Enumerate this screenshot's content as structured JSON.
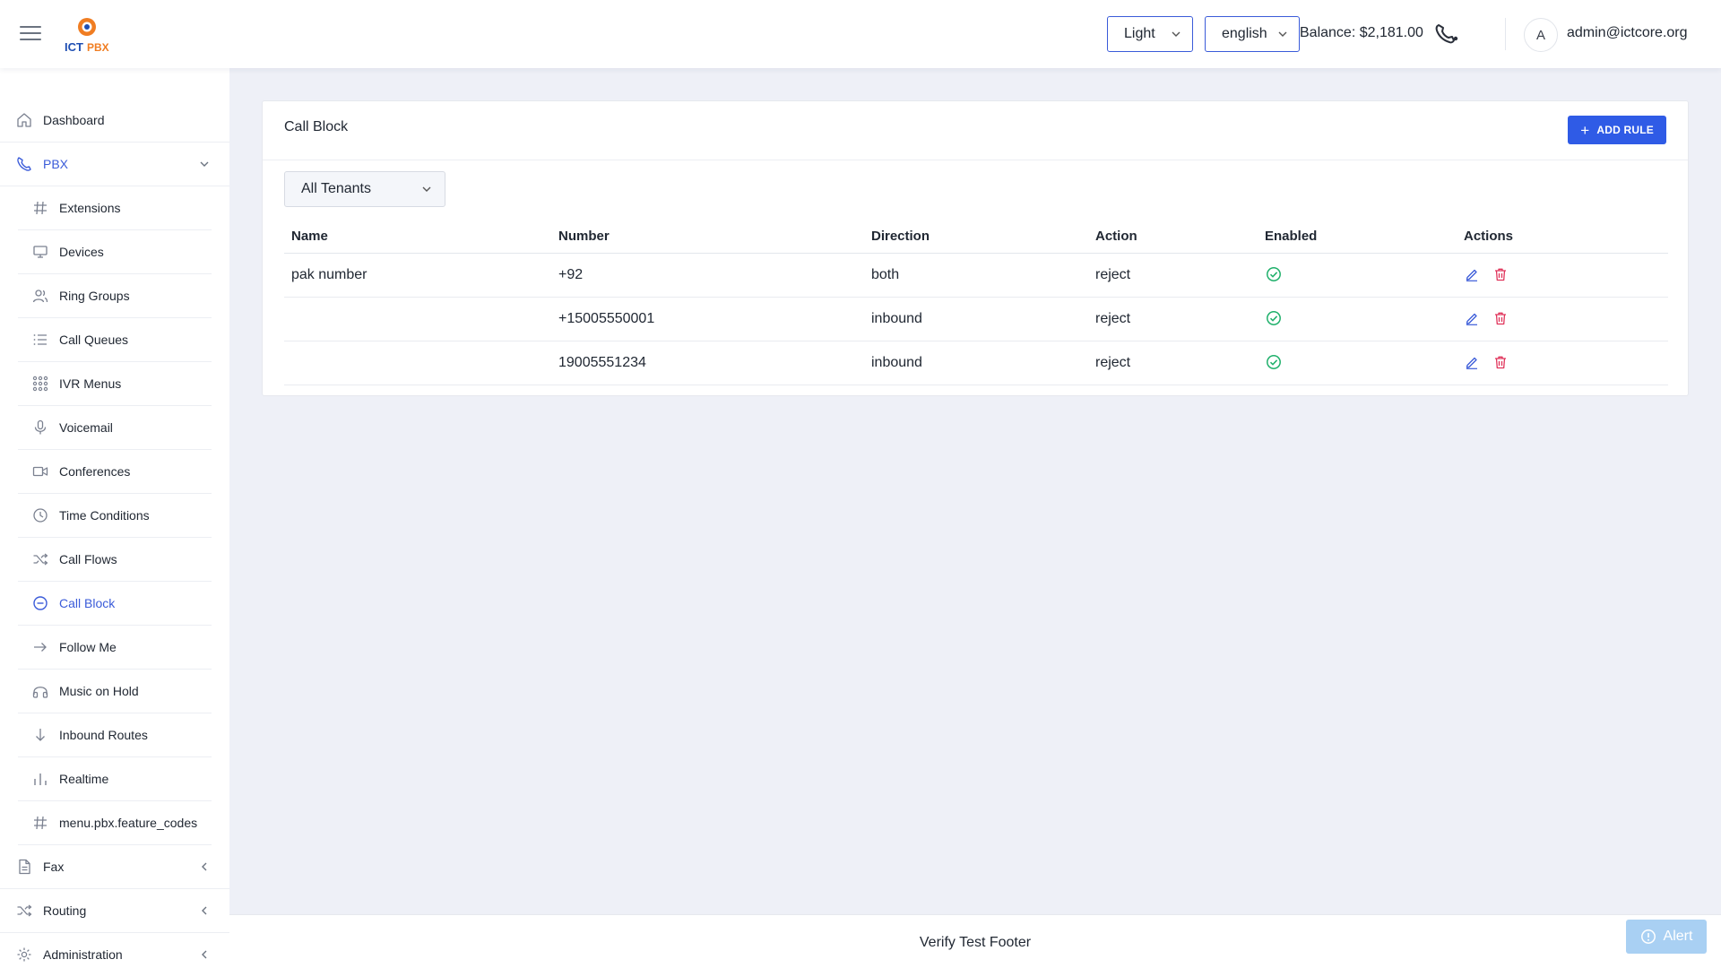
{
  "header": {
    "logo_text": "ICTPBX",
    "theme": {
      "selected": "Light"
    },
    "language": {
      "selected": "english"
    },
    "balance": "Balance: $2,181.00",
    "user": {
      "avatar_initial": "A",
      "email": "admin@ictcore.org"
    }
  },
  "sidebar": {
    "top_items": [
      {
        "label": "Dashboard",
        "icon": "home-icon"
      },
      {
        "label": "PBX",
        "icon": "phone-icon",
        "expanded": true
      }
    ],
    "pbx_items": [
      {
        "label": "Extensions",
        "icon": "hash-icon"
      },
      {
        "label": "Devices",
        "icon": "monitor-icon"
      },
      {
        "label": "Ring Groups",
        "icon": "users-icon"
      },
      {
        "label": "Call Queues",
        "icon": "list-icon"
      },
      {
        "label": "IVR Menus",
        "icon": "grid-icon"
      },
      {
        "label": "Voicemail",
        "icon": "mic-icon"
      },
      {
        "label": "Conferences",
        "icon": "video-icon"
      },
      {
        "label": "Time Conditions",
        "icon": "clock-icon"
      },
      {
        "label": "Call Flows",
        "icon": "shuffle-icon"
      },
      {
        "label": "Call Block",
        "icon": "minus-circle-icon",
        "active": true
      },
      {
        "label": "Follow Me",
        "icon": "arrow-right-icon"
      },
      {
        "label": "Music on Hold",
        "icon": "headphones-icon"
      },
      {
        "label": "Inbound Routes",
        "icon": "arrow-down-icon"
      },
      {
        "label": "Realtime",
        "icon": "bars-icon"
      },
      {
        "label": "menu.pbx.feature_codes",
        "icon": "hash-icon"
      }
    ],
    "bottom_items": [
      {
        "label": "Fax",
        "icon": "file-icon"
      },
      {
        "label": "Routing",
        "icon": "shuffle-icon"
      },
      {
        "label": "Administration",
        "icon": "gear-icon"
      }
    ]
  },
  "main": {
    "title": "Call Block",
    "add_button": "ADD RULE",
    "tenant_filter": {
      "selected": "All Tenants"
    },
    "table": {
      "headers": [
        "Name",
        "Number",
        "Direction",
        "Action",
        "Enabled",
        "Actions"
      ],
      "rows": [
        {
          "name": "pak number",
          "number": "+92",
          "direction": "both",
          "action": "reject",
          "enabled": true
        },
        {
          "name": "",
          "number": "+15005550001",
          "direction": "inbound",
          "action": "reject",
          "enabled": true
        },
        {
          "name": "",
          "number": "19005551234",
          "direction": "inbound",
          "action": "reject",
          "enabled": true
        }
      ]
    }
  },
  "footer": {
    "text": "Verify Test Footer"
  },
  "alert_button": "Alert",
  "colors": {
    "accent": "#3a5bd9",
    "primary_button": "#2f5be6",
    "success": "#1fb06b",
    "danger": "#e0335a",
    "alert": "#a9d0f3",
    "page_bg": "#eef0f7"
  }
}
